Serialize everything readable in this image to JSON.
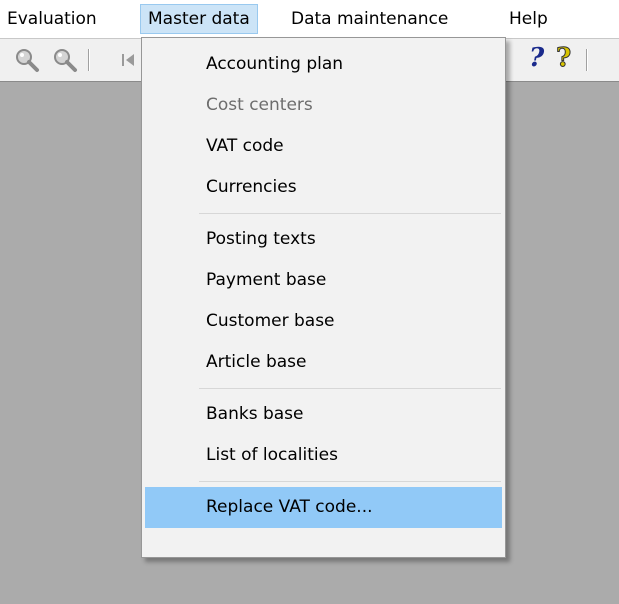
{
  "menubar": {
    "items": [
      {
        "label": "Evaluation"
      },
      {
        "label": "Master data"
      },
      {
        "label": "Data maintenance"
      },
      {
        "label": "Help"
      }
    ]
  },
  "toolbar": {
    "icons": [
      "zoom-in-icon",
      "zoom-out-icon",
      "first-record-icon",
      "context-help-icon",
      "help-icon"
    ],
    "help_glyph": "?",
    "help_colors": {
      "context_help": "#1a2a8c",
      "help": "#d8c400"
    }
  },
  "menu": {
    "groups": [
      {
        "items": [
          {
            "label": "Accounting plan",
            "enabled": true
          },
          {
            "label": "Cost centers",
            "enabled": false
          },
          {
            "label": "VAT code",
            "enabled": true
          },
          {
            "label": "Currencies",
            "enabled": true
          }
        ]
      },
      {
        "items": [
          {
            "label": "Posting texts",
            "enabled": true
          },
          {
            "label": "Payment base",
            "enabled": true
          },
          {
            "label": "Customer base",
            "enabled": true
          },
          {
            "label": "Article base",
            "enabled": true
          }
        ]
      },
      {
        "items": [
          {
            "label": "Banks base",
            "enabled": true
          },
          {
            "label": "List of localities",
            "enabled": true
          }
        ]
      },
      {
        "items": [
          {
            "label": "Replace VAT code...",
            "enabled": true,
            "highlighted": true
          }
        ]
      }
    ]
  },
  "colors": {
    "workspace": "#ababab",
    "menu_bg": "#f2f2f2",
    "highlight": "#91c9f7",
    "active_menubar": "#cce4f7"
  }
}
